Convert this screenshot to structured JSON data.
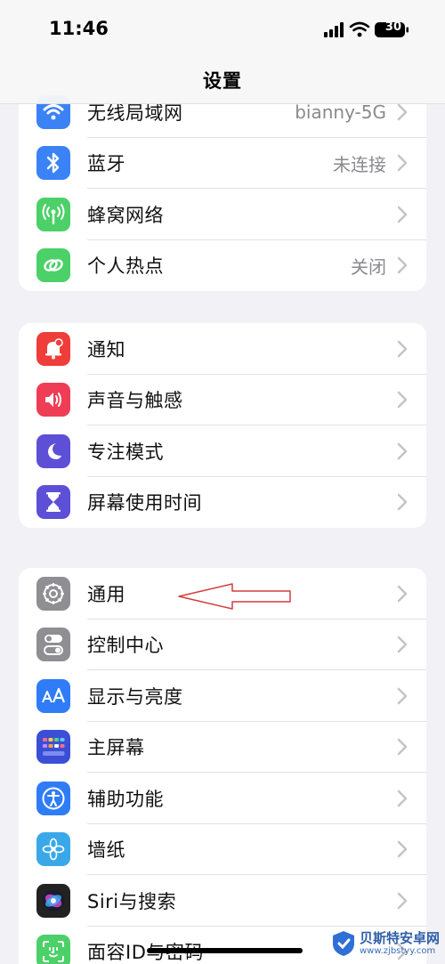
{
  "status_bar": {
    "time": "11:46",
    "battery": "30"
  },
  "nav": {
    "title": "设置"
  },
  "group1": [
    {
      "label": "无线局域网",
      "value": "bianny-5G",
      "icon": "wifi-icon",
      "color": "#3b82f6"
    },
    {
      "label": "蓝牙",
      "value": "未连接",
      "icon": "bluetooth-icon",
      "color": "#3b82f6"
    },
    {
      "label": "蜂窝网络",
      "value": "",
      "icon": "antenna-icon",
      "color": "#4cd068"
    },
    {
      "label": "个人热点",
      "value": "关闭",
      "icon": "link-icon",
      "color": "#4cd068"
    }
  ],
  "group2": [
    {
      "label": "通知",
      "icon": "bell-icon",
      "color": "#ef3d3a"
    },
    {
      "label": "声音与触感",
      "icon": "speaker-icon",
      "color": "#ef3d55"
    },
    {
      "label": "专注模式",
      "icon": "moon-icon",
      "color": "#5d4fd6"
    },
    {
      "label": "屏幕使用时间",
      "icon": "hourglass-icon",
      "color": "#5d4fd6"
    }
  ],
  "group3": [
    {
      "label": "通用",
      "icon": "gear-icon",
      "color": "#8e8e93"
    },
    {
      "label": "控制中心",
      "icon": "toggles-icon",
      "color": "#8e8e93"
    },
    {
      "label": "显示与亮度",
      "icon": "text-size-icon",
      "color": "#2f7cf6"
    },
    {
      "label": "主屏幕",
      "icon": "app-grid-icon",
      "color": "#3a4fd6"
    },
    {
      "label": "辅助功能",
      "icon": "accessibility-icon",
      "color": "#2f7cf6"
    },
    {
      "label": "墙纸",
      "icon": "flower-icon",
      "color": "#3aa8e8"
    },
    {
      "label": "Siri与搜索",
      "icon": "siri-icon",
      "color": "#222222"
    },
    {
      "label": "面容ID与密码",
      "icon": "face-id-icon",
      "color": "#4cd068"
    }
  ],
  "watermark": {
    "name": "贝斯特安卓网",
    "url": "www.zjbstyy.com"
  }
}
